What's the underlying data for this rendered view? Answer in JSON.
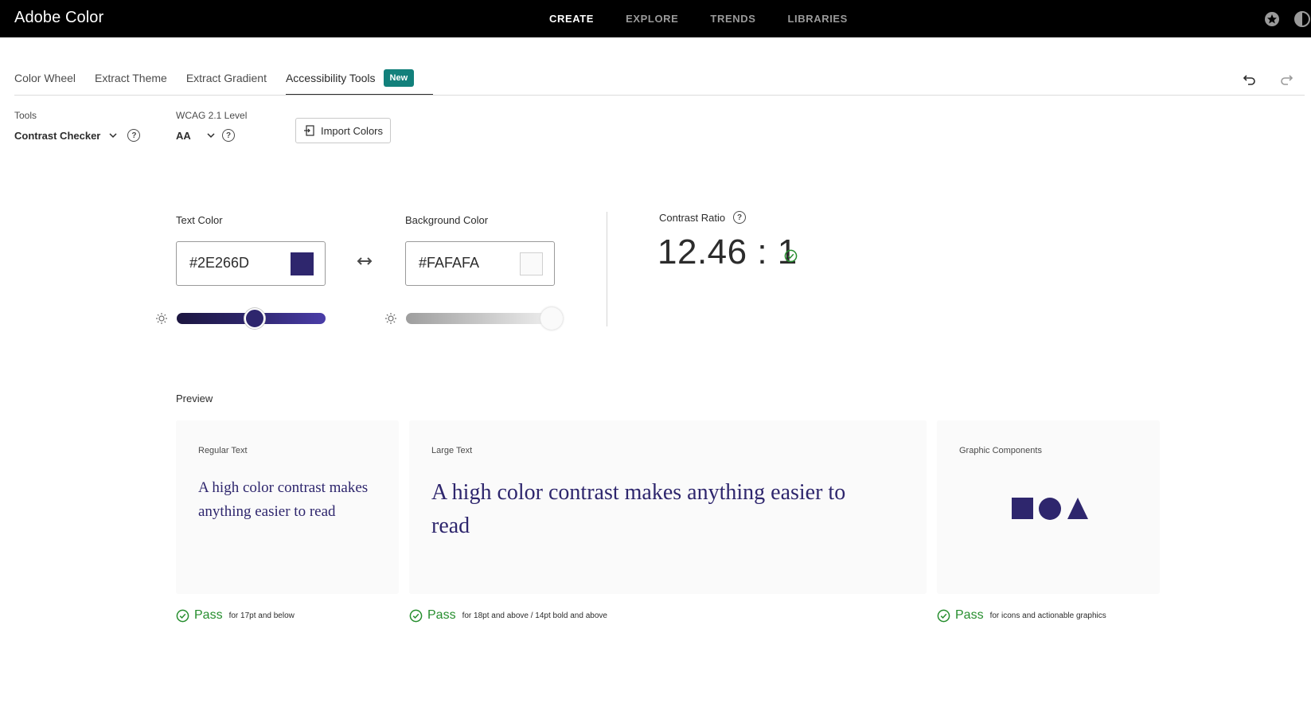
{
  "app": {
    "title": "Adobe Color"
  },
  "topnav": {
    "items": [
      {
        "label": "CREATE",
        "active": true
      },
      {
        "label": "EXPLORE",
        "active": false
      },
      {
        "label": "TRENDS",
        "active": false
      },
      {
        "label": "LIBRARIES",
        "active": false
      }
    ]
  },
  "tabs": {
    "items": [
      {
        "label": "Color Wheel"
      },
      {
        "label": "Extract Theme"
      },
      {
        "label": "Extract Gradient"
      },
      {
        "label": "Accessibility Tools"
      }
    ],
    "new_badge": "New"
  },
  "controls": {
    "tools_label": "Tools",
    "tools_value": "Contrast Checker",
    "wcag_label": "WCAG 2.1 Level",
    "wcag_value": "AA",
    "import_label": "Import Colors"
  },
  "text_color": {
    "label": "Text Color",
    "hex": "#2E266D",
    "brightness_pct": 53
  },
  "background_color": {
    "label": "Background Color",
    "hex": "#FAFAFA",
    "brightness_pct": 100
  },
  "contrast": {
    "label": "Contrast Ratio",
    "value": "12.46 : 1"
  },
  "preview": {
    "label": "Preview",
    "regular": {
      "title": "Regular Text",
      "sample": "A high color contrast makes anything easier to read",
      "pass": "Pass",
      "note": "for 17pt and below"
    },
    "large": {
      "title": "Large Text",
      "sample": "A high color contrast makes anything easier to read",
      "pass": "Pass",
      "note": "for 18pt and above / 14pt bold and above"
    },
    "graphic": {
      "title": "Graphic Components",
      "pass": "Pass",
      "note": "for icons and actionable graphics"
    }
  },
  "colors": {
    "accent": "#12807b",
    "pass_green": "#268e2e",
    "text_sample": "#2e266d",
    "slider_thumb": "#2e266d"
  }
}
